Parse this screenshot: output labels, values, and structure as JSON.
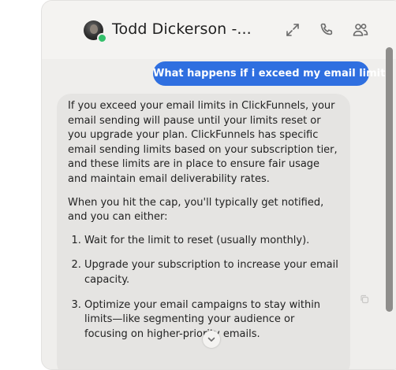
{
  "header": {
    "contact_name": "Todd Dickerson -...",
    "icons": [
      "expand-icon",
      "phone-icon",
      "people-icon"
    ]
  },
  "messages": [
    {
      "role": "user",
      "text": "What happens if i exceed my email limits"
    },
    {
      "role": "assistant",
      "paragraphs": [
        "If you exceed your email limits in ClickFunnels, your email sending will pause until your limits reset or you upgrade your plan. ClickFunnels has specific email sending limits based on your subscription tier, and these limits are in place to ensure fair usage and maintain email deliverability rates.",
        "When you hit the cap, you'll typically get notified, and you can either:"
      ],
      "list": [
        "Wait for the limit to reset (usually monthly).",
        "Upgrade your subscription to increase your email capacity.",
        "Optimize your email campaigns to stay within limits—like segmenting your audience or focusing on higher-priority emails."
      ]
    }
  ],
  "colors": {
    "user_bubble": "#2f6fe0",
    "assistant_bubble": "#e5e4e2",
    "panel_bg": "#efeeec",
    "status_online": "#34c06b"
  }
}
